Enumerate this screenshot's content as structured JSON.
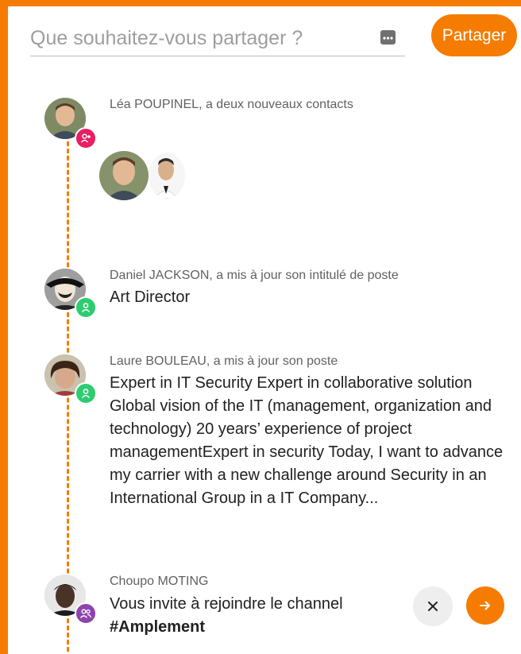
{
  "composer": {
    "placeholder": "Que souhaitez-vous partager ?",
    "more_icon": "more-horizontal-icon",
    "share_label": "Partager"
  },
  "colors": {
    "accent": "#f57c00",
    "badge_contacts": "#e91e63",
    "badge_profile": "#2ecc71",
    "badge_channel": "#8e44ad"
  },
  "feed": [
    {
      "header": "Léa POUPINEL, a deux nouveaux contacts",
      "badge_icon": "person-add-icon"
    },
    {
      "header": "Daniel JACKSON, a mis à jour son intitulé de poste",
      "body": "Art Director",
      "badge_icon": "person-icon"
    },
    {
      "header": "Laure BOULEAU, a mis à jour son poste",
      "body": "Expert in IT Security Expert in collaborative solution Global vision of the IT (management, organization and technology) 20 years’ experience of project managementExpert in security Today, I want to advance my carrier with a new challenge around Security in an International Group in a IT Company...",
      "badge_icon": "person-icon"
    },
    {
      "header": "Choupo MOTING",
      "body_line": "Vous invite à rejoindre le channel",
      "channel": "#Amplement",
      "badge_icon": "group-icon",
      "dismiss_icon": "close-icon",
      "accept_icon": "arrow-right-icon"
    }
  ]
}
